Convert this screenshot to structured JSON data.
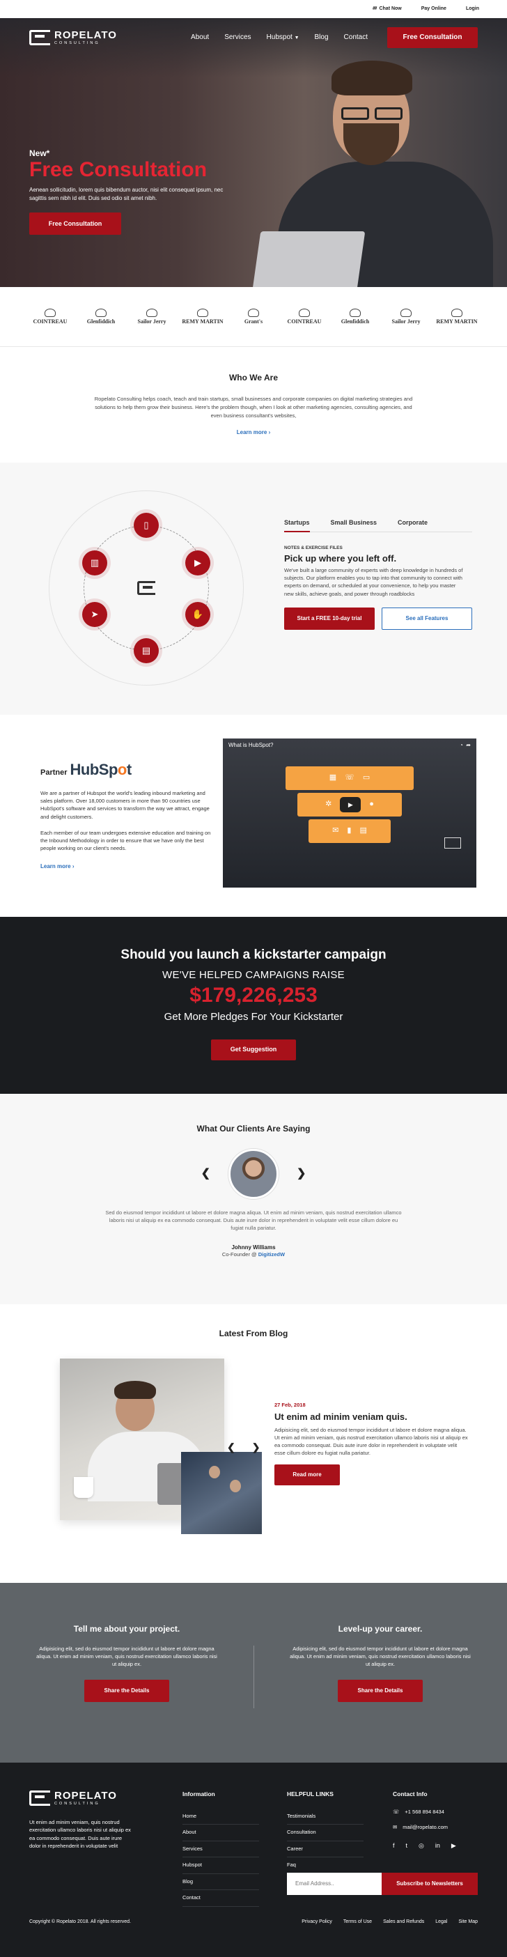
{
  "topbar": {
    "chat": "Chat Now",
    "pay": "Pay Online",
    "login": "Login"
  },
  "brand": {
    "name": "ROPELATO",
    "tagline": "CONSULTING"
  },
  "nav": {
    "items": [
      "About",
      "Services",
      "Hubspot",
      "Blog",
      "Contact"
    ],
    "cta": "Free Consultation"
  },
  "hero": {
    "eyebrow": "New*",
    "title": "Free Consultation",
    "text": "Aenean sollicitudin, lorem quis bibendum auctor, nisi elit consequat ipsum, nec sagittis sem nibh id elit. Duis sed odio sit amet nibh.",
    "button": "Free Consultation"
  },
  "brands": [
    "COINTREAU",
    "Glenfiddich",
    "Sailor Jerry",
    "REMY MARTIN",
    "Grant's",
    "COINTREAU",
    "Glenfiddich",
    "Sailor Jerry",
    "REMY MARTIN"
  ],
  "who": {
    "title": "Who We Are",
    "text": "Ropelato Consulting helps coach, teach and train startups, small businesses and corporate companies on digital marketing strategies and solutions to help them grow their business. Here's the problem though, when I look at other marketing agencies, consulting agencies, and even business consultant's websites,",
    "link": "Learn more"
  },
  "features": {
    "tabs": [
      "Startups",
      "Small Business",
      "Corporate"
    ],
    "eyebrow": "NOTES & EXERCISE FILES",
    "title": "Pick up where you left off.",
    "text": "We've built a large community of experts with deep knowledge in hundreds of subjects. Our platform enables you to tap into that community to connect with experts on demand, or scheduled at your convenience, to help you master new skills, achieve goals, and power through roadblocks",
    "primary": "Start a FREE 10-day trial",
    "secondary": "See all Features"
  },
  "partner": {
    "pre": "Partner",
    "hub_a": "HubSp",
    "hub_b": "o",
    "hub_c": "t",
    "p1": "We are a partner of Hubspot the world's leading inbound marketing and sales platform. Over 18,000 customers in more than 90 countries use HubSpot's software and services to transform the way we attract, engage and delight customers.",
    "p2": "Each member of our team undergoes extensive education and training on the Inbound Methodology in order to ensure that we have only the best people working on our client's needs.",
    "link": "Learn more",
    "video_title": "What is HubSpot?"
  },
  "kick": {
    "title": "Should you launch a kickstarter campaign",
    "sub": "WE'VE HELPED CAMPAIGNS RAISE",
    "amount": "$179,226,253",
    "tag": "Get More Pledges For Your Kickstarter",
    "button": "Get Suggestion"
  },
  "testimonials": {
    "title": "What Our Clients Are Saying",
    "quote": "Sed do eiusmod tempor incididunt ut labore et dolore magna aliqua. Ut enim ad minim veniam, quis nostrud exercitation ullamco laboris nisi ut aliquip ex ea commodo consequat. Duis aute irure dolor in reprehenderit in voluptate velit esse cillum dolore eu fugiat nulla pariatur.",
    "name": "Johnny Williams",
    "role": "Co-Founder @",
    "company": "DigitizedW"
  },
  "blog": {
    "title": "Latest From Blog",
    "date": "27 Feb, 2018",
    "post_title": "Ut enim ad minim veniam quis.",
    "text": "Adipisicing elit, sed do eiusmod tempor incididunt ut labore et dolore magna aliqua. Ut enim ad minim veniam, quis nostrud exercitation ullamco laboris nisi ut aliquip ex ea commodo consequat. Duis aute irure dolor in reprehenderit in voluptate velit esse cillum dolore eu fugiat nulla pariatur.",
    "button": "Read more"
  },
  "cta": {
    "left_title": "Tell me about your project.",
    "left_text": "Adipisicing elit, sed do eiusmod tempor incididunt ut labore et dolore magna aliqua. Ut enim ad minim veniam, quis nostrud exercitation ullamco laboris nisi ut aliquip ex.",
    "right_title": "Level-up your career.",
    "right_text": "Adipisicing elit, sed do eiusmod tempor incididunt ut labore et dolore magna aliqua. Ut enim ad minim veniam, quis nostrud exercitation ullamco laboris nisi ut aliquip ex.",
    "button": "Share the Details"
  },
  "footer": {
    "about": "Ut enim ad minim veniam, quis nostrud exercitation ullamco laboris nisi ut aliquip ex ea commodo consequat. Duis aute irure dolor in reprehenderit in voluptate velit",
    "info_title": "Information",
    "info": [
      "Home",
      "About",
      "Services",
      "Hubspot",
      "Blog",
      "Contact"
    ],
    "help_title": "HELPFUL LINKS",
    "help": [
      "Testimonials",
      "Consultation",
      "Career",
      "Faq"
    ],
    "contact_title": "Contact Info",
    "phone": "+1 568 894 8434",
    "email": "mail@ropelato.com",
    "newsletter_placeholder": "Email Address..",
    "newsletter_button": "Subscribe to Newsletters",
    "copyright": "Copyright © Ropelato 2018. All rights reserved.",
    "bottom_links": [
      "Privacy Policy",
      "Terms of Use",
      "Sales and Refunds",
      "Legal",
      "Site Map"
    ]
  },
  "colors": {
    "accent": "#a8111a",
    "link": "#2a6ebb",
    "dark": "#1a1c1f"
  }
}
